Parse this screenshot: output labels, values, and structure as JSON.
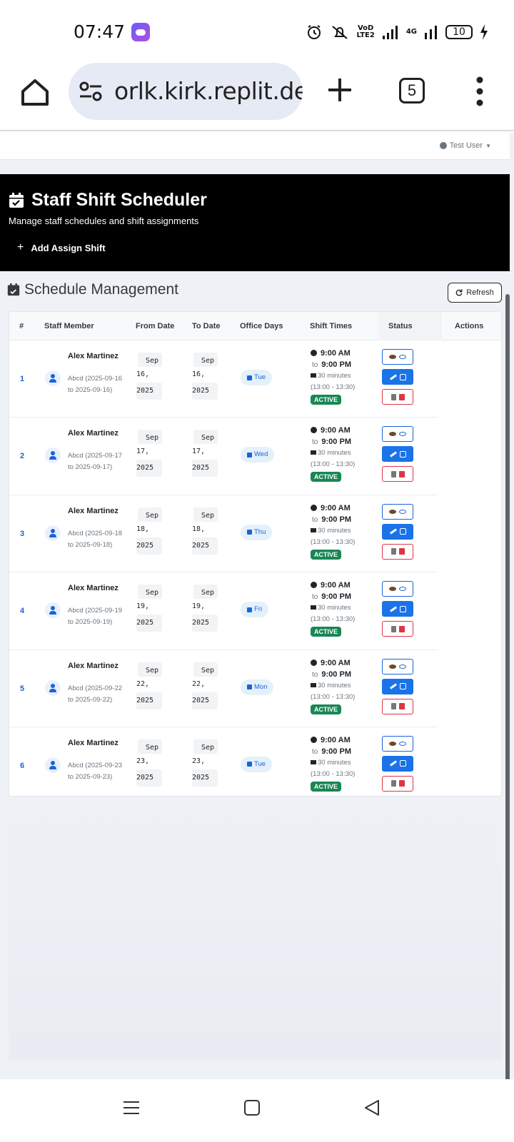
{
  "status_bar": {
    "time": "07:47",
    "volte": "VoD\nLTE2",
    "network": "4G",
    "battery": "10"
  },
  "browser": {
    "url": "orlk.kirk.replit.dev",
    "tab_count": "5"
  },
  "app": {
    "user_menu": "Test User",
    "title": "Staff Shift Scheduler",
    "subtitle": "Manage staff schedules and shift assignments",
    "add_button": "Add Assign Shift",
    "section_title": "Schedule Management",
    "refresh_button": "Refresh"
  },
  "table": {
    "headers": [
      "#",
      "Staff Member",
      "From Date",
      "To Date",
      "Office Days",
      "Shift Times",
      "Status",
      "Actions"
    ],
    "rows": [
      {
        "num": "1",
        "name": "Alex Martinez",
        "note": "Abcd (2025-09-16 to 2025-09-16)",
        "from_mon": "Sep",
        "from_day": "16,",
        "from_year": "2025",
        "to_mon": "Sep",
        "to_day": "16,",
        "to_year": "2025",
        "day": "Tue",
        "start": "9:00 AM",
        "to_word": "to",
        "end": "9:00 PM",
        "break": "30 minutes",
        "break_time": "(13:00 - 13:30)",
        "status": "ACTIVE"
      },
      {
        "num": "2",
        "name": "Alex Martinez",
        "note": "Abcd (2025-09-17 to 2025-09-17)",
        "from_mon": "Sep",
        "from_day": "17,",
        "from_year": "2025",
        "to_mon": "Sep",
        "to_day": "17,",
        "to_year": "2025",
        "day": "Wed",
        "start": "9:00 AM",
        "to_word": "to",
        "end": "9:00 PM",
        "break": "30 minutes",
        "break_time": "(13:00 - 13:30)",
        "status": "ACTIVE"
      },
      {
        "num": "3",
        "name": "Alex Martinez",
        "note": "Abcd (2025-09-18 to 2025-09-18)",
        "from_mon": "Sep",
        "from_day": "18,",
        "from_year": "2025",
        "to_mon": "Sep",
        "to_day": "18,",
        "to_year": "2025",
        "day": "Thu",
        "start": "9:00 AM",
        "to_word": "to",
        "end": "9:00 PM",
        "break": "30 minutes",
        "break_time": "(13:00 - 13:30)",
        "status": "ACTIVE"
      },
      {
        "num": "4",
        "name": "Alex Martinez",
        "note": "Abcd (2025-09-19 to 2025-09-19)",
        "from_mon": "Sep",
        "from_day": "19,",
        "from_year": "2025",
        "to_mon": "Sep",
        "to_day": "19,",
        "to_year": "2025",
        "day": "Fri",
        "start": "9:00 AM",
        "to_word": "to",
        "end": "9:00 PM",
        "break": "30 minutes",
        "break_time": "(13:00 - 13:30)",
        "status": "ACTIVE"
      },
      {
        "num": "5",
        "name": "Alex Martinez",
        "note": "Abcd (2025-09-22 to 2025-09-22)",
        "from_mon": "Sep",
        "from_day": "22,",
        "from_year": "2025",
        "to_mon": "Sep",
        "to_day": "22,",
        "to_year": "2025",
        "day": "Mon",
        "start": "9:00 AM",
        "to_word": "to",
        "end": "9:00 PM",
        "break": "30 minutes",
        "break_time": "(13:00 - 13:30)",
        "status": "ACTIVE"
      },
      {
        "num": "6",
        "name": "Alex Martinez",
        "note": "Abcd (2025-09-23 to 2025-09-23)",
        "from_mon": "Sep",
        "from_day": "23,",
        "from_year": "2025",
        "to_mon": "Sep",
        "to_day": "23,",
        "to_year": "2025",
        "day": "Tue",
        "start": "9:00 AM",
        "to_word": "to",
        "end": "9:00 PM",
        "break": "30 minutes",
        "break_time": "(13:00 - 13:30)",
        "status": "ACTIVE"
      }
    ]
  },
  "colors": {
    "primary": "#1a73e8",
    "active": "#198754",
    "danger": "#dc3545",
    "hero": "#000000"
  }
}
